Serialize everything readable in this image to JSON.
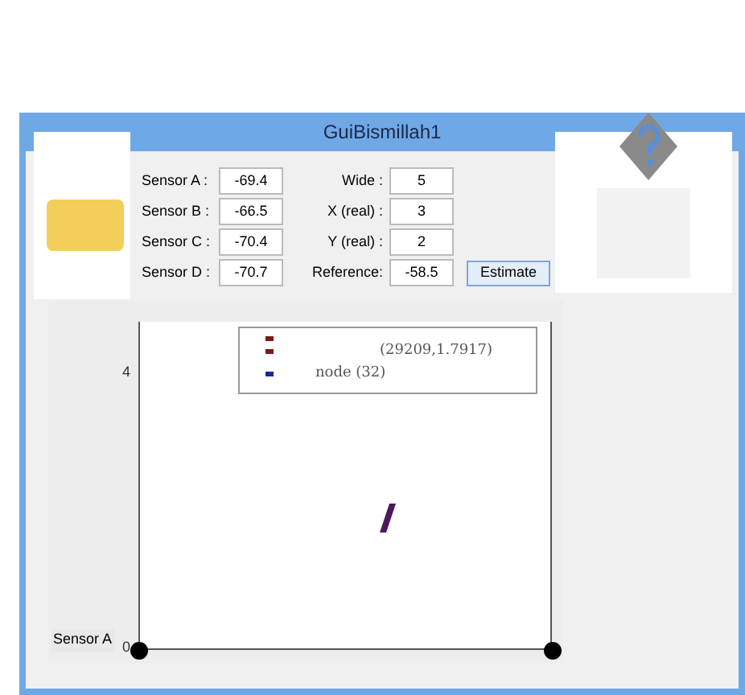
{
  "window": {
    "title": "GuiBismillah1"
  },
  "sensors": [
    {
      "label": "Sensor A :",
      "value": "-69.4"
    },
    {
      "label": "Sensor B :",
      "value": "-66.5"
    },
    {
      "label": "Sensor C :",
      "value": "-70.4"
    },
    {
      "label": "Sensor D :",
      "value": "-70.7"
    }
  ],
  "parameters": [
    {
      "label": "Wide :",
      "value": "5"
    },
    {
      "label": "X (real) :",
      "value": "3"
    },
    {
      "label": "Y (real) :",
      "value": "2"
    },
    {
      "label": "Reference:",
      "value": "-58.5"
    }
  ],
  "estimate_button": "Estimate",
  "plot": {
    "y_tick_labels": [
      "4",
      "0"
    ],
    "legend": [
      {
        "color": "#7a1a1a"
      },
      {
        "color": "#7a1a1a",
        "text": "(29209,1.7917)"
      },
      {
        "color": "#1a2a9a",
        "text": "node (32)"
      }
    ],
    "axis_label": "Sensor A"
  }
}
